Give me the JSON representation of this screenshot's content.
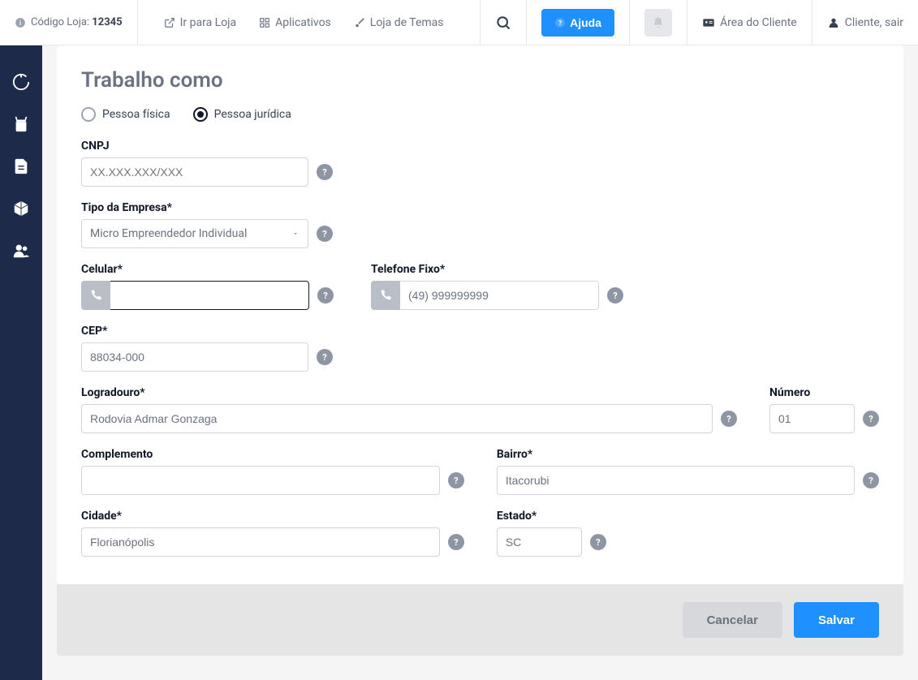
{
  "top": {
    "codigo_label": "Código Loja:",
    "codigo_value": "12345",
    "ir_loja": "Ir para Loja",
    "aplicativos": "Aplicativos",
    "loja_temas": "Loja de Temas",
    "ajuda": "Ajuda",
    "area_cliente": "Área do Cliente",
    "cliente_sair": "Cliente, sair"
  },
  "card": {
    "title": "Trabalho como",
    "radio_pf": "Pessoa física",
    "radio_pj": "Pessoa jurídica",
    "cnpj_label": "CNPJ",
    "cnpj_placeholder": "XX.XXX.XXX/XXX",
    "tipo_label": "Tipo da Empresa*",
    "tipo_value": "Micro Empreendedor Individual",
    "celular_label": "Celular*",
    "celular_value": "",
    "telefone_label": "Telefone Fixo*",
    "telefone_value": "(49) 999999999",
    "cep_label": "CEP*",
    "cep_value": "88034-000",
    "logradouro_label": "Logradouro*",
    "logradouro_value": "Rodovia Admar Gonzaga",
    "numero_label": "Número",
    "numero_value": "01",
    "complemento_label": "Complemento",
    "complemento_value": "",
    "bairro_label": "Bairro*",
    "bairro_value": "Itacorubi",
    "cidade_label": "Cidade*",
    "cidade_value": "Florianópolis",
    "estado_label": "Estado*",
    "estado_value": "SC"
  },
  "footer": {
    "cancelar": "Cancelar",
    "salvar": "Salvar"
  }
}
